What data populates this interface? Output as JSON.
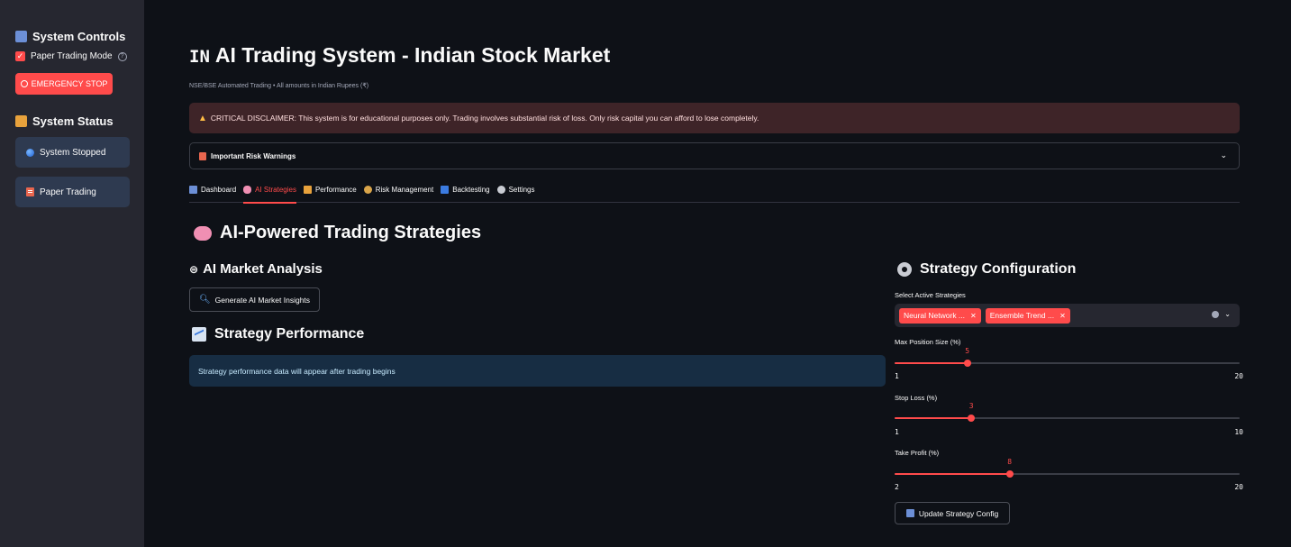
{
  "sidebar": {
    "controls_heading": "System Controls",
    "paper_mode_label": "Paper Trading Mode",
    "paper_mode_checked": true,
    "emergency_label": "EMERGENCY STOP",
    "status_heading": "System Status",
    "status_card": "System Stopped",
    "mode_card": "Paper Trading"
  },
  "header": {
    "flag": "IN",
    "title": "AI Trading System - Indian Stock Market",
    "caption": "NSE/BSE Automated Trading • All amounts in Indian Rupees (₹)"
  },
  "disclaimer": "CRITICAL DISCLAIMER: This system is for educational purposes only. Trading involves substantial risk of loss. Only risk capital you can afford to lose completely.",
  "expander_label": "Important Risk Warnings",
  "tabs": [
    {
      "label": "Dashboard",
      "icon": "chart-icon",
      "color": "#6c8fd6",
      "active": false
    },
    {
      "label": "AI Strategies",
      "icon": "brain-icon",
      "color": "#f08fb3",
      "active": true
    },
    {
      "label": "Performance",
      "icon": "bar-chart-icon",
      "color": "#e8a23c",
      "active": false
    },
    {
      "label": "Risk Management",
      "icon": "scales-icon",
      "color": "#d9a54a",
      "active": false
    },
    {
      "label": "Backtesting",
      "icon": "rewind-icon",
      "color": "#3b7be0",
      "active": false
    },
    {
      "label": "Settings",
      "icon": "gear-icon",
      "color": "#c9ccd3",
      "active": false
    }
  ],
  "main": {
    "section_title": "AI-Powered Trading Strategies",
    "analysis_title": "AI Market Analysis",
    "generate_button": "Generate AI Market Insights",
    "performance_title": "Strategy Performance",
    "performance_info": "Strategy performance data will appear after trading begins"
  },
  "config": {
    "title": "Strategy Configuration",
    "select_label": "Select Active Strategies",
    "selected": [
      "Neural Network ...",
      "Ensemble Trend ..."
    ],
    "sliders": [
      {
        "label": "Max Position Size (%)",
        "value": 5,
        "min": 1,
        "max": 20
      },
      {
        "label": "Stop Loss (%)",
        "value": 3,
        "min": 1,
        "max": 10
      },
      {
        "label": "Take Profit (%)",
        "value": 8,
        "min": 2,
        "max": 20
      }
    ],
    "update_button": "Update Strategy Config"
  },
  "colors": {
    "accent": "#ff4b4b",
    "background": "#0e1117",
    "sidebar": "#262730",
    "info": "#172d43",
    "warning_bg": "#3e2428"
  }
}
